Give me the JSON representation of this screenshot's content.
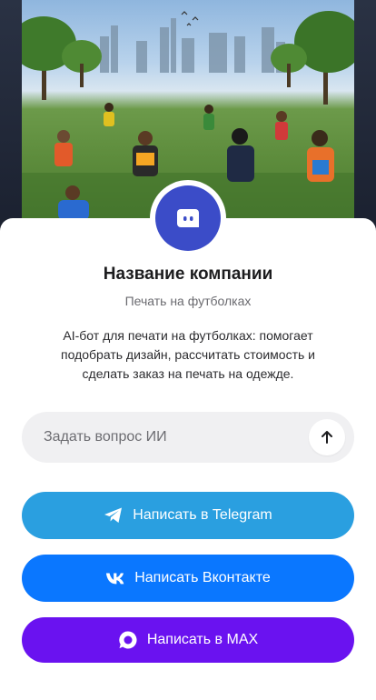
{
  "hero": {
    "image_name": "park-tshirts-photo"
  },
  "company": {
    "name": "Название компании",
    "subtitle": "Печать на футболках",
    "description": "AI-бот для печати на футболках: помогает подобрать дизайн, рассчитать стоимость и сделать заказ на печать на одежде."
  },
  "ask": {
    "placeholder": "Задать вопрос ИИ",
    "send_icon": "arrow-up-icon"
  },
  "buttons": {
    "telegram": {
      "label": "Написать в Telegram",
      "icon": "telegram-icon",
      "color": "#2a9fe0"
    },
    "vk": {
      "label": "Написать Вконтакте",
      "icon": "vk-icon",
      "color": "#0a77ff"
    },
    "max": {
      "label": "Написать в MAX",
      "icon": "max-icon",
      "color": "#6a12f0"
    }
  },
  "colors": {
    "avatar": "#3b4cc8",
    "sheet": "#ffffff"
  }
}
